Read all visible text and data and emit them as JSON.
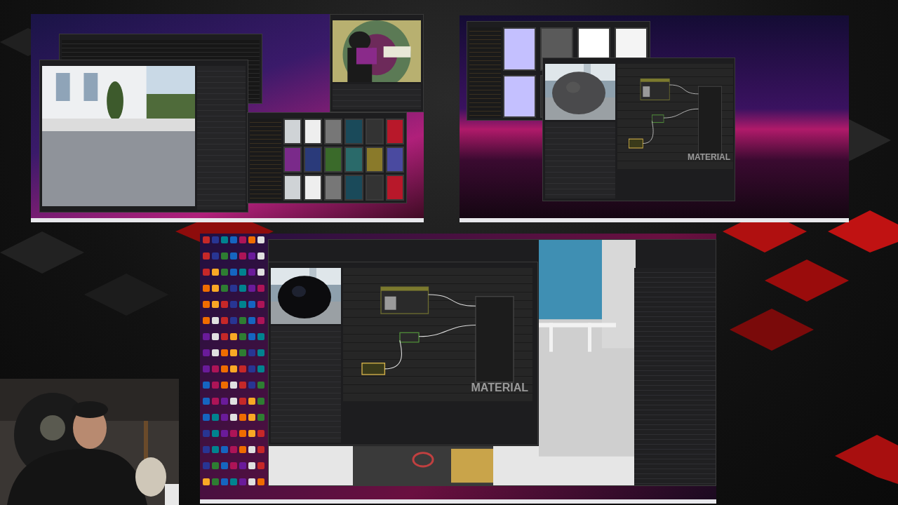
{
  "screens": [
    {
      "kind": "level-editor"
    },
    {
      "kind": "material-editor",
      "watermark": "MATERIAL"
    },
    {
      "kind": "desktop-editor",
      "watermark": "MATERIAL"
    }
  ]
}
